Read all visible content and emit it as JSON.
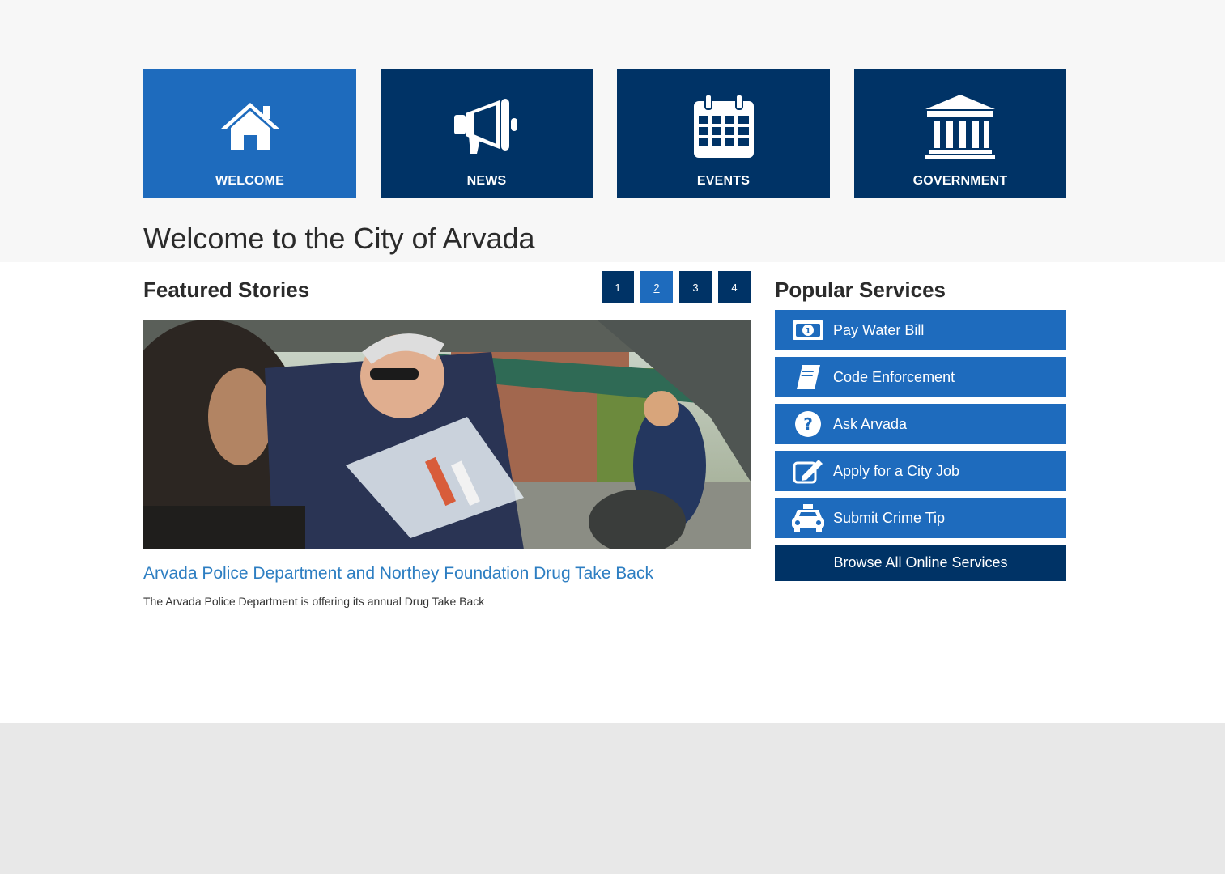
{
  "nav_tiles": [
    {
      "label": "WELCOME",
      "icon": "home-icon"
    },
    {
      "label": "NEWS",
      "icon": "megaphone-icon"
    },
    {
      "label": "EVENTS",
      "icon": "calendar-icon"
    },
    {
      "label": "GOVERNMENT",
      "icon": "government-building-icon"
    }
  ],
  "page_title": "Welcome to the City of Arvada",
  "featured": {
    "heading": "Featured Stories",
    "pages": [
      "1",
      "2",
      "3",
      "4"
    ],
    "active_page": "2",
    "story": {
      "title": "Arvada Police Department and Northey Foundation Drug Take Back",
      "description": "The Arvada Police Department is offering its annual Drug Take Back"
    }
  },
  "services": {
    "heading": "Popular Services",
    "items": [
      {
        "label": "Pay Water Bill",
        "icon": "money-bill-icon"
      },
      {
        "label": "Code Enforcement",
        "icon": "book-icon"
      },
      {
        "label": "Ask Arvada",
        "icon": "question-circle-icon"
      },
      {
        "label": "Apply for a City Job",
        "icon": "edit-icon"
      },
      {
        "label": "Submit Crime Tip",
        "icon": "taxi-icon"
      }
    ],
    "browse_label": "Browse All Online Services"
  },
  "colors": {
    "dark_navy": "#003366",
    "accent_blue": "#1e6bbd",
    "link_blue": "#2d7ec2"
  }
}
